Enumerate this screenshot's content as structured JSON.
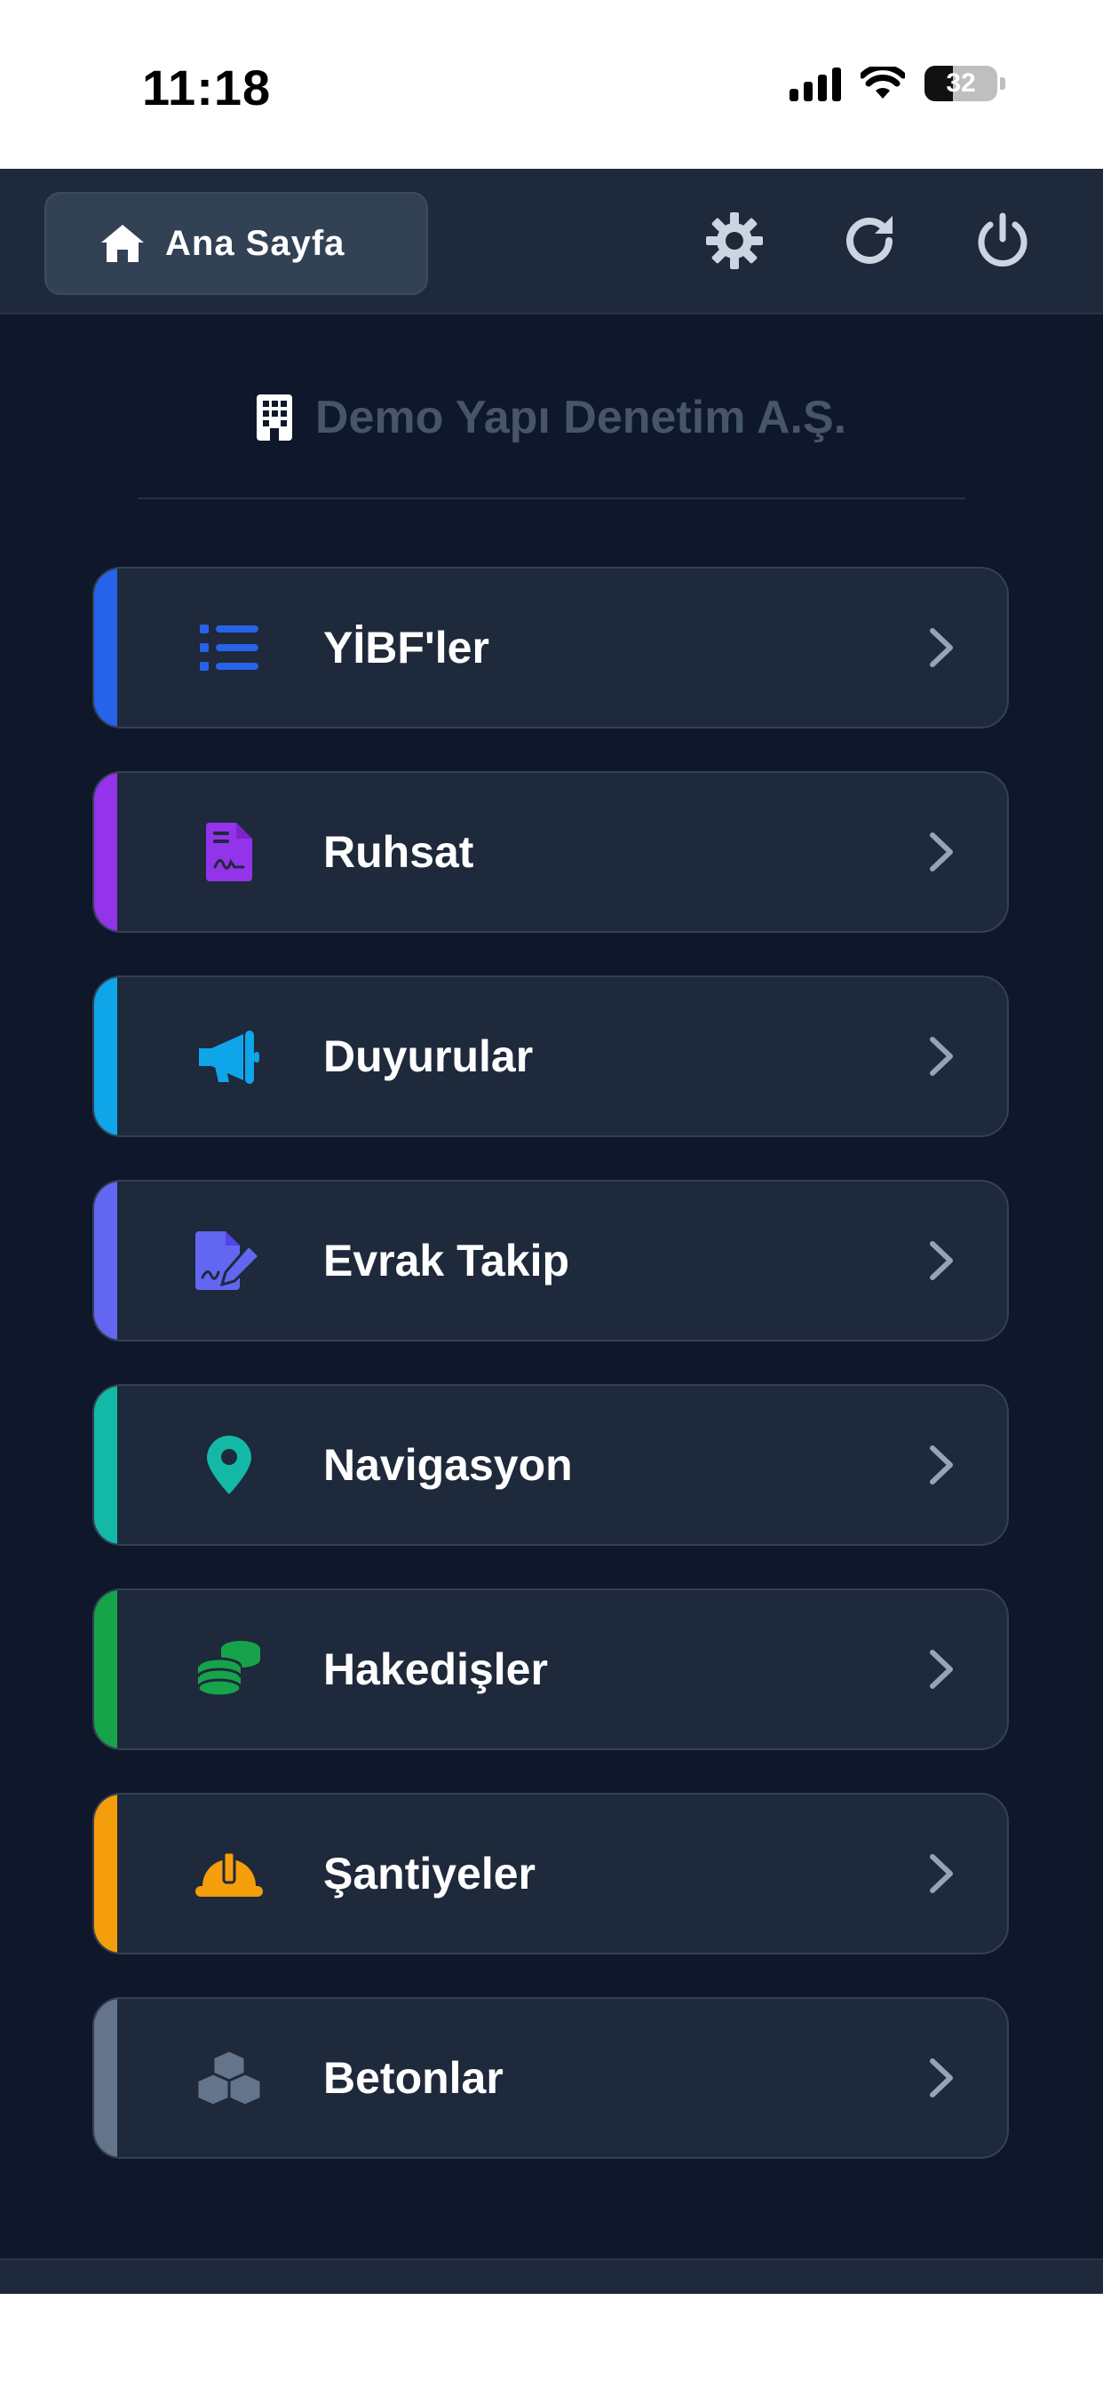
{
  "status": {
    "time": "11:18",
    "battery": "32"
  },
  "topbar": {
    "home_label": "Ana Sayfa"
  },
  "company": {
    "name": "Demo Yapı Denetim A.Ş."
  },
  "menu": [
    {
      "label": "YİBF'ler",
      "icon": "list-icon",
      "color": "#2563eb"
    },
    {
      "label": "Ruhsat",
      "icon": "signed-document-icon",
      "color": "#9333ea"
    },
    {
      "label": "Duyurular",
      "icon": "megaphone-icon",
      "color": "#0ea5e9"
    },
    {
      "label": "Evrak Takip",
      "icon": "document-edit-icon",
      "color": "#6366f1"
    },
    {
      "label": "Navigasyon",
      "icon": "map-pin-icon",
      "color": "#14b8a6"
    },
    {
      "label": "Hakedişler",
      "icon": "coins-icon",
      "color": "#16a34a"
    },
    {
      "label": "Şantiyeler",
      "icon": "hard-hat-icon",
      "color": "#f59e0b"
    },
    {
      "label": "Betonlar",
      "icon": "cubes-icon",
      "color": "#64748b"
    }
  ]
}
